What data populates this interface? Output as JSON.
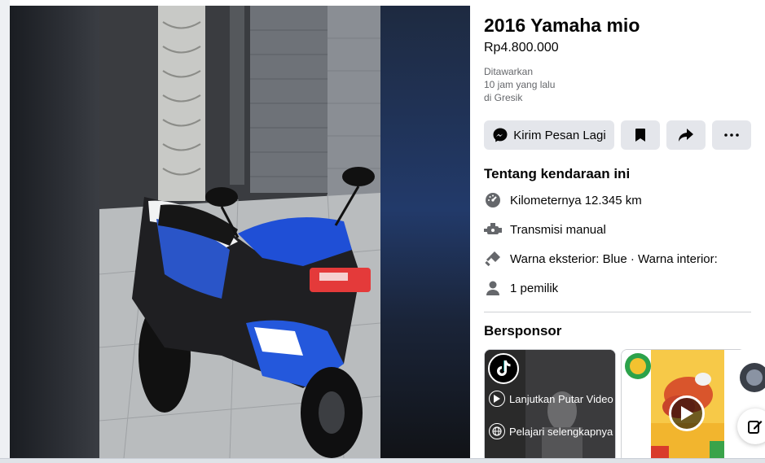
{
  "listing": {
    "title": "2016 Yamaha mio",
    "price": "Rp4.800.000",
    "meta_offered": "Ditawarkan",
    "meta_time": "10 jam yang lalu",
    "meta_location": "di Gresik"
  },
  "actions": {
    "message_label": "Kirim Pesan Lagi",
    "message_icon": "messenger-icon",
    "save_icon": "bookmark-icon",
    "share_icon": "share-icon",
    "more_icon": "more-icon"
  },
  "about": {
    "heading": "Tentang kendaraan ini",
    "specs": [
      {
        "icon": "speedometer-icon",
        "text": "Kilometernya 12.345 km"
      },
      {
        "icon": "transmission-icon",
        "text": "Transmisi manual"
      },
      {
        "icon": "paint-icon",
        "text": "Warna eksterior: Blue · Warna interior:"
      },
      {
        "icon": "person-icon",
        "text": "1 pemilik"
      }
    ]
  },
  "sponsored": {
    "heading": "Bersponsor",
    "card1": {
      "brand_icon": "tiktok-icon",
      "continue_label": "Lanjutkan Putar Video",
      "learn_label": "Pelajari selengkapnya"
    },
    "card2": {
      "play_icon": "play-icon"
    }
  },
  "colors": {
    "accent": "#1877f2",
    "button_bg": "#e4e6eb",
    "text": "#050505",
    "secondary_text": "#65676b"
  }
}
